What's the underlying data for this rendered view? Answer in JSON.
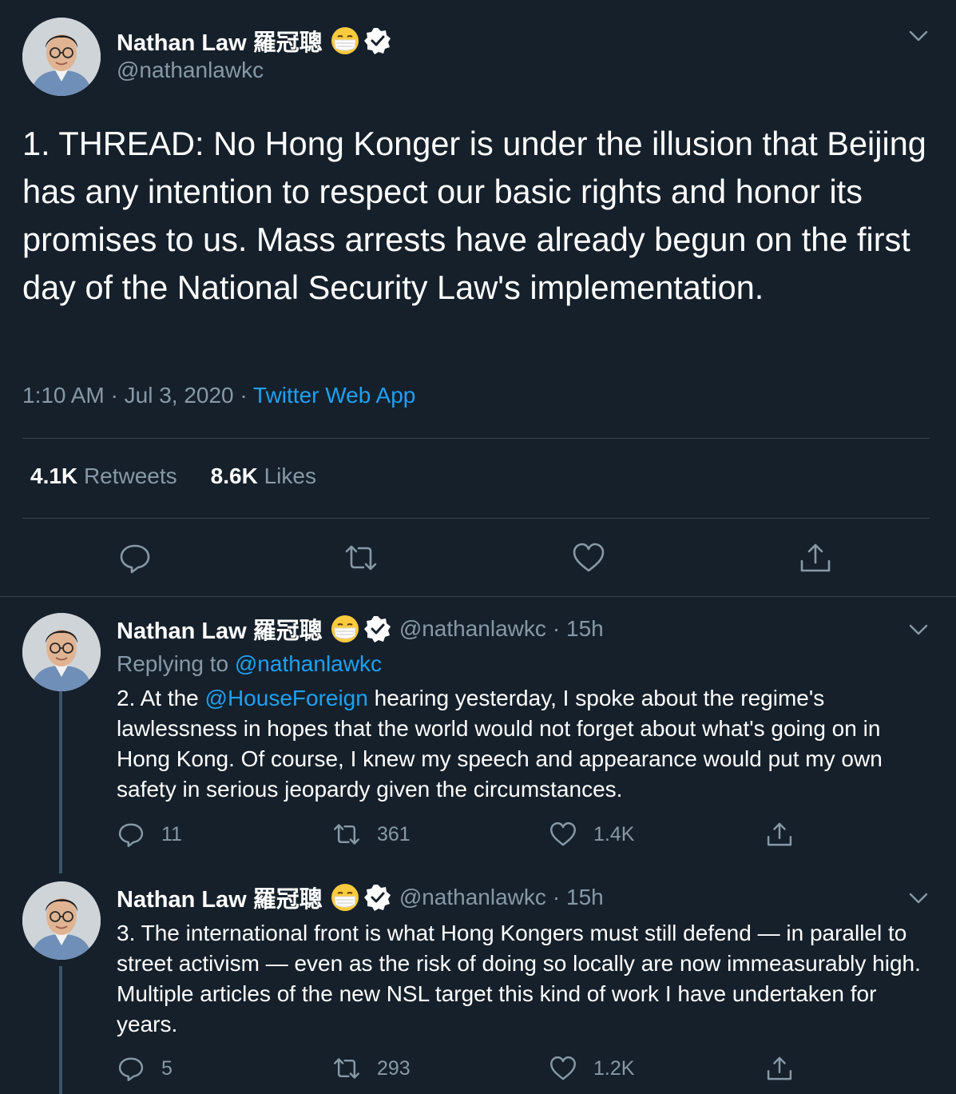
{
  "colors": {
    "background": "#15202b",
    "divider": "#38444d",
    "secondary_text": "#8899a6",
    "link": "#1da1f2",
    "primary_text": "#ffffff"
  },
  "main_tweet": {
    "author_name": "Nathan Law 羅冠聰",
    "author_emoji": "face-with-medical-mask",
    "verified": true,
    "handle": "@nathanlawkc",
    "text": "1. THREAD: No Hong Konger is under the illusion that Beijing has any intention to respect our basic rights and honor its promises to us. Mass arrests have already begun on the first day of the National Security Law's implementation.",
    "time": "1:10 AM",
    "date": "Jul 3, 2020",
    "separator": "·",
    "source": "Twitter Web App",
    "retweets_count": "4.1K",
    "retweets_label": "Retweets",
    "likes_count": "8.6K",
    "likes_label": "Likes",
    "actions": [
      "reply-icon",
      "retweet-icon",
      "like-icon",
      "share-icon"
    ]
  },
  "replies": [
    {
      "author_name": "Nathan Law 羅冠聰",
      "handle": "@nathanlawkc",
      "time_ago": "· 15h",
      "replying_label": "Replying to",
      "replying_to": "@nathanlawkc",
      "text_prefix": "2. At the ",
      "mention": "@HouseForeign",
      "text_suffix": " hearing yesterday, I spoke about the regime's lawlessness in hopes that the world would not forget about what's going on in Hong Kong. Of course, I knew my speech and appearance would put my own safety in serious jeopardy given the circumstances.",
      "reply_count": "11",
      "retweet_count": "361",
      "like_count": "1.4K"
    },
    {
      "author_name": "Nathan Law 羅冠聰",
      "handle": "@nathanlawkc",
      "time_ago": "· 15h",
      "text": "3. The international front is what Hong Kongers must still defend — in parallel to street activism — even as the risk of doing so locally are now immeasurably high. Multiple articles of the new NSL target this kind of work I have undertaken for years.",
      "reply_count": "5",
      "retweet_count": "293",
      "like_count": "1.2K"
    }
  ]
}
